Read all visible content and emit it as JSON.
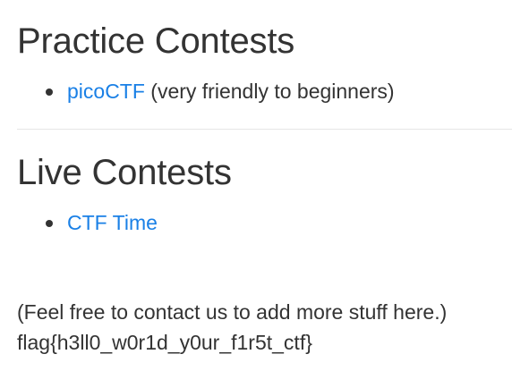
{
  "sections": {
    "practice": {
      "title": "Practice Contests",
      "items": [
        {
          "link": "picoCTF",
          "suffix": " (very friendly to beginners)"
        }
      ]
    },
    "live": {
      "title": "Live Contests",
      "items": [
        {
          "link": "CTF Time",
          "suffix": ""
        }
      ]
    }
  },
  "footer": {
    "contact_note": "(Feel free to contact us to add more stuff here.)",
    "flag": "flag{h3ll0_w0r1d_y0ur_f1r5t_ctf}"
  },
  "colors": {
    "text": "#333333",
    "link": "#1a80e6",
    "divider": "#e5e5e5"
  }
}
